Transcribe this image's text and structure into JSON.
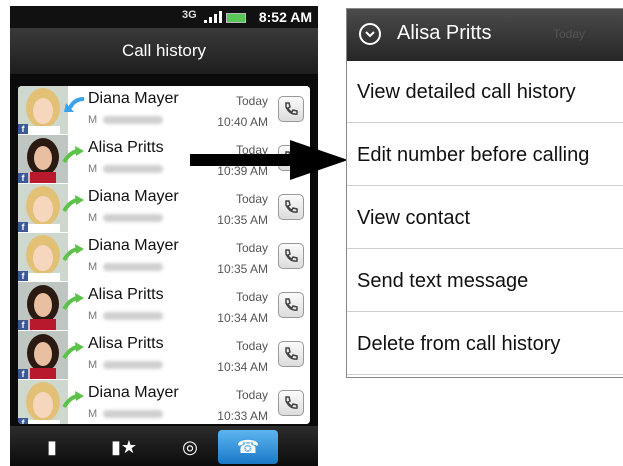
{
  "status": {
    "signal_label": "3G",
    "time": "8:52 AM"
  },
  "header": {
    "title": "Call history"
  },
  "calls": [
    {
      "name": "Diana Mayer",
      "num_prefix": "M",
      "day": "Today",
      "time": "10:40 AM",
      "call_type": "incoming",
      "photo": "blonde"
    },
    {
      "name": "Alisa Pritts",
      "num_prefix": "M",
      "day": "Today",
      "time": "10:39 AM",
      "call_type": "outgoing",
      "photo": "brunette"
    },
    {
      "name": "Diana Mayer",
      "num_prefix": "M",
      "day": "Today",
      "time": "10:35 AM",
      "call_type": "outgoing",
      "photo": "blonde"
    },
    {
      "name": "Diana Mayer",
      "num_prefix": "M",
      "day": "Today",
      "time": "10:35 AM",
      "call_type": "outgoing",
      "photo": "blonde"
    },
    {
      "name": "Alisa Pritts",
      "num_prefix": "M",
      "day": "Today",
      "time": "10:34 AM",
      "call_type": "outgoing",
      "photo": "brunette"
    },
    {
      "name": "Alisa Pritts",
      "num_prefix": "M",
      "day": "Today",
      "time": "10:34 AM",
      "call_type": "outgoing",
      "photo": "brunette"
    },
    {
      "name": "Diana Mayer",
      "num_prefix": "M",
      "day": "Today",
      "time": "10:33 AM",
      "call_type": "outgoing",
      "photo": "blonde"
    }
  ],
  "tabs": [
    {
      "icon": "person-icon",
      "active": false
    },
    {
      "icon": "favorite-person-icon",
      "active": false
    },
    {
      "icon": "globe-icon",
      "active": false
    },
    {
      "icon": "call-history-icon",
      "active": true
    }
  ],
  "menu": {
    "title": "Alisa Pritts",
    "background_text": "Today",
    "items": [
      "View detailed call history",
      "Edit number before calling",
      "View contact",
      "Send text message",
      "Delete from call history"
    ]
  },
  "colors": {
    "incoming_arrow": "#3aa3e8",
    "outgoing_arrow": "#5cc24a",
    "active_tab": "#2a8ad8",
    "facebook": "#3b5998"
  }
}
